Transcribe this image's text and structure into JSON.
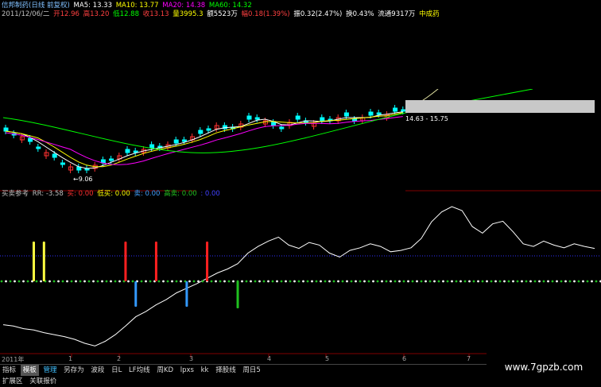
{
  "header": {
    "stock_name": "信邦制药(日线 前复权)",
    "ma5": "MA5: 13.33",
    "ma10": "MA10: 13.77",
    "ma20": "MA20: 14.38",
    "ma60": "MA60: 14.32",
    "date": "2011/12/06/二",
    "open": "开12.96",
    "high": "高13.20",
    "low": "低12.88",
    "close": "收13.13",
    "volume": "量3995.3",
    "amount": "额5523万",
    "change": "幅0.18(1.39%)",
    "amplitude": "振0.32(2.47%)",
    "turnover": "换0.43%",
    "float": "流通9317万",
    "sector": "中成药"
  },
  "price_annotations": {
    "low_label": "9.06",
    "range_label": "14.63 - 15.75"
  },
  "indicator": {
    "name": "买卖参考",
    "rr": "RR: -3.58",
    "buy": "买: 0.00",
    "low_buy": "低买: 0.00",
    "sell": "卖: 0.00",
    "high_sell": "高卖: 0.00",
    "extra": ": 0.00"
  },
  "x_axis": {
    "year": "2011年",
    "months": [
      "1",
      "2",
      "3",
      "4",
      "5",
      "6",
      "7"
    ]
  },
  "tabs": [
    {
      "label": "指标",
      "active": false
    },
    {
      "label": "模板",
      "active": true
    },
    {
      "label": "管理",
      "active": false
    },
    {
      "label": "另存为",
      "active": false
    },
    {
      "label": "波段",
      "active": false
    },
    {
      "label": "日L",
      "active": false
    },
    {
      "label": "LF均线",
      "active": false
    },
    {
      "label": "周KD",
      "active": false
    },
    {
      "label": "lpxs",
      "active": false
    },
    {
      "label": "kk",
      "active": false
    },
    {
      "label": "择股线",
      "active": false
    },
    {
      "label": "周日5",
      "active": false
    }
  ],
  "bottom": {
    "expand": "扩展区",
    "related": "关联报价"
  },
  "watermark": "www.7gpzb.com",
  "colors": {
    "ma5": "#ffffff",
    "ma10": "#ffff00",
    "ma20": "#ff00ff",
    "ma60": "#00ff00",
    "up": "#ff3030",
    "down": "#00ffff",
    "sell_bar": "#ff2020",
    "buy_bar": "#3399ff",
    "low_buy_bar": "#ffff40",
    "high_sell_bar": "#20c020"
  },
  "chart_data": {
    "type": "line",
    "title": "买卖参考",
    "series": [
      {
        "name": "RR",
        "values": [
          -60,
          -62,
          -66,
          -68,
          -72,
          -75,
          -78,
          -82,
          -88,
          -92,
          -85,
          -75,
          -62,
          -48,
          -40,
          -30,
          -22,
          -12,
          -5,
          2,
          10,
          18,
          24,
          32,
          48,
          58,
          66,
          72,
          60,
          55,
          64,
          60,
          48,
          42,
          52,
          56,
          62,
          58,
          50,
          52,
          56,
          70,
          95,
          110,
          118,
          112,
          88,
          78,
          92,
          96,
          80,
          62,
          58,
          66,
          60,
          56,
          62,
          58,
          55
        ]
      }
    ],
    "signals": {
      "sell": [
        12,
        15,
        20
      ],
      "buy": [
        13,
        18
      ],
      "low_buy": [
        3,
        4
      ],
      "high_sell": [
        23
      ]
    }
  }
}
